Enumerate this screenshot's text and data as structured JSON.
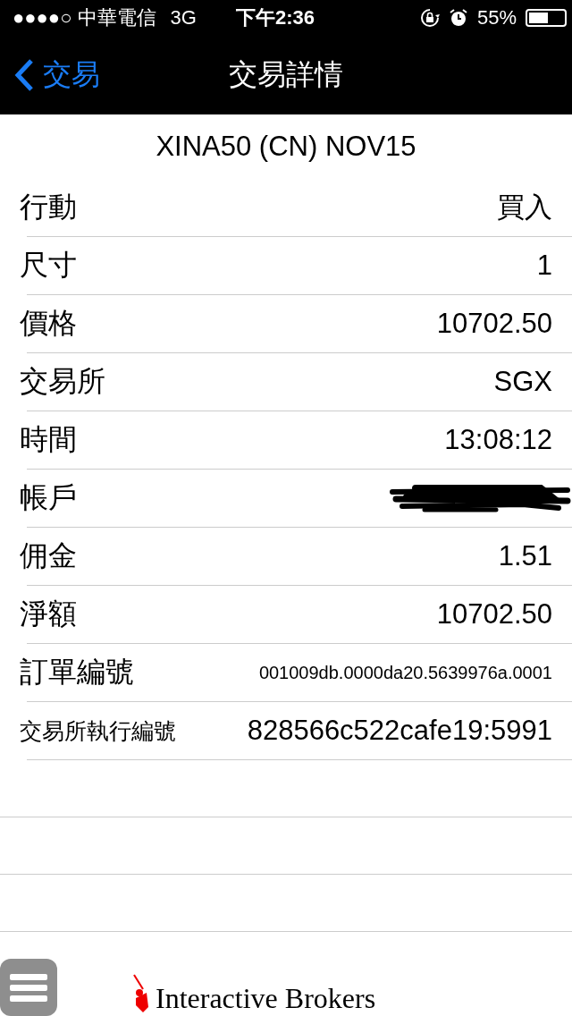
{
  "status_bar": {
    "carrier": "●●●●○ 中華電信",
    "network": "3G",
    "time": "下午2:36",
    "battery": "55%"
  },
  "nav": {
    "back": "交易",
    "title": "交易詳情"
  },
  "contract": "XINA50 (CN) NOV15",
  "rows": [
    {
      "label": "行動",
      "value": "買入",
      "kind": "normal"
    },
    {
      "label": "尺寸",
      "value": "1",
      "kind": "normal"
    },
    {
      "label": "價格",
      "value": "10702.50",
      "kind": "normal"
    },
    {
      "label": "交易所",
      "value": "SGX",
      "kind": "normal"
    },
    {
      "label": "時間",
      "value": "13:08:12",
      "kind": "normal"
    },
    {
      "label": "帳戶",
      "kind": "redacted"
    },
    {
      "label": "佣金",
      "value": "1.51",
      "kind": "normal"
    },
    {
      "label": "淨額",
      "value": "10702.50",
      "kind": "normal"
    },
    {
      "label": "訂單編號",
      "value": "001009db.0000da20.5639976a.0001",
      "kind": "small_value"
    },
    {
      "label": "交易所執行編號",
      "value": "828566c522cafe19:5991",
      "kind": "small_label"
    }
  ],
  "footer": {
    "brand": "Interactive Brokers"
  }
}
